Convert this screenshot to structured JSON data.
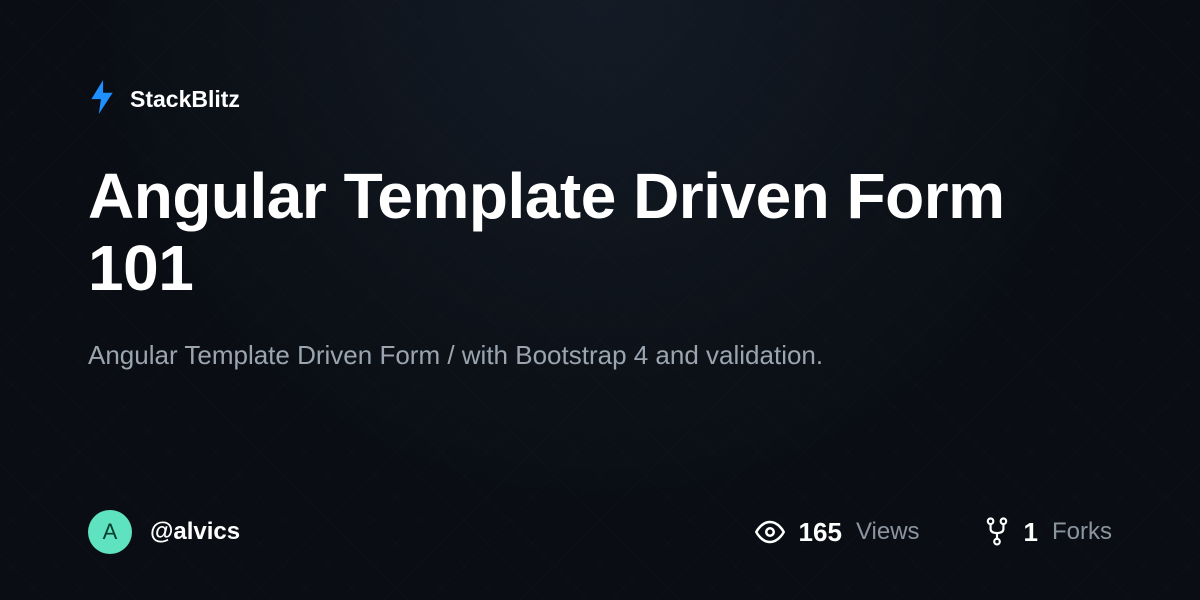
{
  "brand": {
    "name": "StackBlitz",
    "accent_color": "#1e90ff"
  },
  "project": {
    "title": "Angular Template Driven Form 101",
    "description": "Angular Template Driven Form / with Bootstrap 4 and validation."
  },
  "author": {
    "initial": "A",
    "handle": "@alvics"
  },
  "stats": {
    "views": {
      "count": "165",
      "label": "Views"
    },
    "forks": {
      "count": "1",
      "label": "Forks"
    }
  }
}
